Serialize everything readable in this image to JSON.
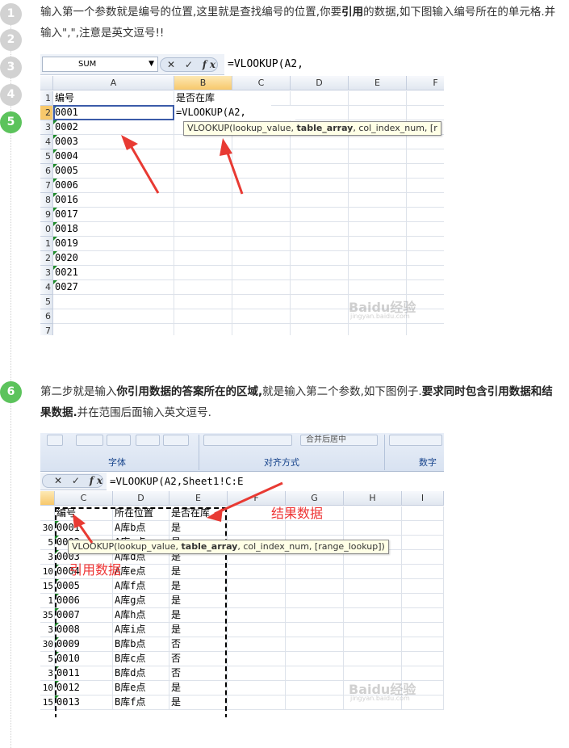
{
  "steps": [
    {
      "badges": [
        "1",
        "2",
        "3",
        "4",
        "5"
      ],
      "text_before": "输入第一个参数就是编号的位置,这里就是查找编号的位置,你要",
      "text_bold": "引用",
      "text_after": "的数据,如下图输入编号所在的单元格.并输入\",\",注意是英文逗号!!"
    },
    {
      "badge": "6",
      "text_a": "第二步就是输入",
      "text_b_bold": "你引用数据的答案所在的区域,",
      "text_c": "就是输入第二个参数,如下图例子.",
      "text_d_bold": "要求同时包含引用数据和结果数据.",
      "text_e": "并在范围后面输入英文逗号."
    }
  ],
  "shot1": {
    "name_box": "SUM",
    "formula": "=VLOOKUP(A2,",
    "fx_buttons": "✕ ✓",
    "fx_label": "fx",
    "columns": [
      "A",
      "B",
      "C",
      "D",
      "E",
      "F"
    ],
    "row_numbers": [
      "1",
      "2",
      "3",
      "4",
      "5",
      "6",
      "7",
      "8",
      "9",
      "0",
      "1",
      "2",
      "3",
      "4",
      "5",
      "6",
      "7"
    ],
    "col_a": [
      "编号",
      "0001",
      "0002",
      "0003",
      "0004",
      "0005",
      "0006",
      "0016",
      "0017",
      "0018",
      "0019",
      "0020",
      "0021",
      "0027",
      "",
      "",
      ""
    ],
    "b1": "是否在库",
    "b2": "=VLOOKUP(A2,",
    "tooltip_pre": "VLOOKUP(lookup_value, ",
    "tooltip_bold": "table_array",
    "tooltip_post": ", col_index_num, [r",
    "watermark": "Baidu经验",
    "watermark_sub": "jingyan.baidu.com"
  },
  "shot2": {
    "ribbon_groups": [
      "字体",
      "对齐方式",
      "数字"
    ],
    "ribbon_button": "合并后居中",
    "formula": "=VLOOKUP(A2,Sheet1!C:E",
    "fx_buttons": "✕ ✓",
    "fx_label": "fx",
    "columns": [
      "C",
      "D",
      "E",
      "F",
      "G",
      "H",
      "I"
    ],
    "header_row": [
      "编号",
      "所在位置",
      "是否在库"
    ],
    "rows": [
      {
        "lead": "30",
        "c": "0001",
        "d": "A库b点",
        "e": "是"
      },
      {
        "lead": "5",
        "c": "0002",
        "d": "A库c点",
        "e": "是"
      },
      {
        "lead": "3",
        "c": "0003",
        "d": "A库d点",
        "e": "是"
      },
      {
        "lead": "10",
        "c": "0004",
        "d": "A库e点",
        "e": "是"
      },
      {
        "lead": "15",
        "c": "0005",
        "d": "A库f点",
        "e": "是"
      },
      {
        "lead": "1",
        "c": "0006",
        "d": "A库g点",
        "e": "是"
      },
      {
        "lead": "35",
        "c": "0007",
        "d": "A库h点",
        "e": "是"
      },
      {
        "lead": "3",
        "c": "0008",
        "d": "A库i点",
        "e": "是"
      },
      {
        "lead": "30",
        "c": "0009",
        "d": "B库b点",
        "e": "否"
      },
      {
        "lead": "5",
        "c": "0010",
        "d": "B库c点",
        "e": "否"
      },
      {
        "lead": "3",
        "c": "0011",
        "d": "B库d点",
        "e": "否"
      },
      {
        "lead": "10",
        "c": "0012",
        "d": "B库e点",
        "e": "是"
      },
      {
        "lead": "15",
        "c": "0013",
        "d": "B库f点",
        "e": "是"
      }
    ],
    "tooltip_pre": "VLOOKUP(lookup_value, ",
    "tooltip_bold": "table_array",
    "tooltip_post": ", col_index_num, [range_lookup])",
    "annotation_result": "结果数据",
    "annotation_ref": "引用数据",
    "watermark": "Baidu经验",
    "watermark_sub": "jingyan.baidu.com"
  },
  "colors": {
    "badge_gray": "#d2d2d2",
    "badge_green": "#5cc35c",
    "arrow_red": "#e83a33",
    "selected_header": "#f7c86b"
  }
}
